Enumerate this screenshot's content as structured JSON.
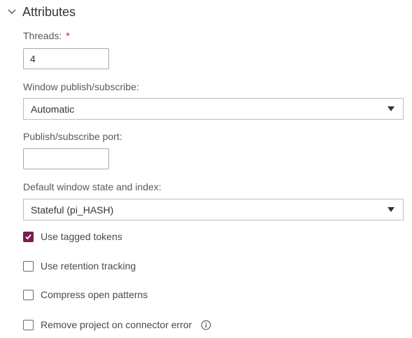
{
  "section": {
    "title": "Attributes",
    "icon": "chevron-down-icon"
  },
  "threads": {
    "label": "Threads:",
    "required_mark": "*",
    "value": "4"
  },
  "window_pubsub": {
    "label": "Window publish/subscribe:",
    "selected": "Automatic"
  },
  "pubsub_port": {
    "label": "Publish/subscribe port:",
    "value": ""
  },
  "default_window_state": {
    "label": "Default window state and index:",
    "selected": "Stateful (pi_HASH)"
  },
  "checkboxes": [
    {
      "label": "Use tagged tokens",
      "checked": true
    },
    {
      "label": "Use retention tracking",
      "checked": false
    },
    {
      "label": "Compress open patterns",
      "checked": false
    },
    {
      "label": "Remove project on connector error",
      "checked": false,
      "info_icon": "info-icon"
    }
  ],
  "colors": {
    "accent": "#7b1d50",
    "required": "#c8102e",
    "border": "#a9a9a9"
  }
}
